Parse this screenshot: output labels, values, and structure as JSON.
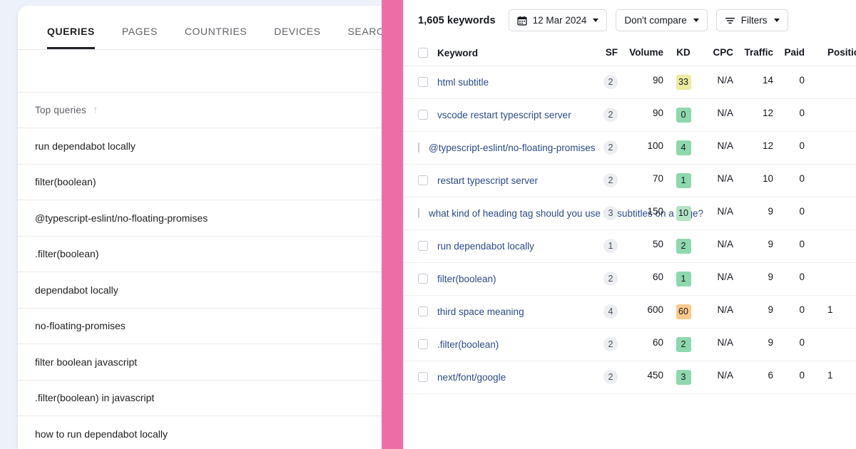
{
  "left_panel": {
    "tabs": [
      {
        "label": "QUERIES",
        "active": true
      },
      {
        "label": "PAGES",
        "active": false
      },
      {
        "label": "COUNTRIES",
        "active": false
      },
      {
        "label": "DEVICES",
        "active": false
      },
      {
        "label": "SEARCH A",
        "active": false
      }
    ],
    "table_header": {
      "queries_label": "Top queries",
      "sort_asc_icon": "arrow-up-icon",
      "sort_desc_icon": "arrow-down-icon"
    },
    "queries": [
      "run dependabot locally",
      "filter(boolean)",
      "@typescript-eslint/no-floating-promises",
      ".filter(boolean)",
      "dependabot locally",
      "no-floating-promises",
      "filter boolean javascript",
      ".filter(boolean) in javascript",
      "how to run dependabot locally"
    ]
  },
  "divider": {
    "color": "#ed6ea7"
  },
  "right_panel": {
    "toolbar": {
      "keyword_count": "1,605 keywords",
      "date_icon": "calendar-icon",
      "date_label": "12 Mar 2024",
      "compare_label": "Don't compare",
      "filters_icon": "filter-icon",
      "filters_label": "Filters"
    },
    "columns": [
      "Keyword",
      "SF",
      "Volume",
      "KD",
      "CPC",
      "Traffic",
      "Paid",
      "Positio"
    ],
    "kd_colors": {
      "green_dark": "#8ed8ae",
      "green_light": "#b3e3c4",
      "yellow": "#ecebA0",
      "orange": "#fbc98a"
    },
    "rows": [
      {
        "keyword": "html subtitle",
        "sf": "2",
        "volume": "90",
        "kd": "33",
        "kd_color": "#eceba0",
        "cpc": "N/A",
        "traffic": "14",
        "paid": "0",
        "position": ""
      },
      {
        "keyword": "vscode restart typescript server",
        "sf": "2",
        "volume": "90",
        "kd": "0",
        "kd_color": "#8ed8ae",
        "cpc": "N/A",
        "traffic": "12",
        "paid": "0",
        "position": ""
      },
      {
        "keyword": "@typescript-eslint/no-floating-promises",
        "sf": "2",
        "volume": "100",
        "kd": "4",
        "kd_color": "#8ed8ae",
        "cpc": "N/A",
        "traffic": "12",
        "paid": "0",
        "position": ""
      },
      {
        "keyword": "restart typescript server",
        "sf": "2",
        "volume": "70",
        "kd": "1",
        "kd_color": "#8ed8ae",
        "cpc": "N/A",
        "traffic": "10",
        "paid": "0",
        "position": ""
      },
      {
        "keyword": "what kind of heading tag should you use for subtitles on a page?",
        "sf": "3",
        "volume": "150",
        "kd": "10",
        "kd_color": "#b3e3c4",
        "cpc": "N/A",
        "traffic": "9",
        "paid": "0",
        "position": ""
      },
      {
        "keyword": "run dependabot locally",
        "sf": "1",
        "volume": "50",
        "kd": "2",
        "kd_color": "#8ed8ae",
        "cpc": "N/A",
        "traffic": "9",
        "paid": "0",
        "position": ""
      },
      {
        "keyword": "filter(boolean)",
        "sf": "2",
        "volume": "60",
        "kd": "1",
        "kd_color": "#8ed8ae",
        "cpc": "N/A",
        "traffic": "9",
        "paid": "0",
        "position": ""
      },
      {
        "keyword": "third space meaning",
        "sf": "4",
        "volume": "600",
        "kd": "60",
        "kd_color": "#fbc98a",
        "cpc": "N/A",
        "traffic": "9",
        "paid": "0",
        "position": "1"
      },
      {
        "keyword": ".filter(boolean)",
        "sf": "2",
        "volume": "60",
        "kd": "2",
        "kd_color": "#8ed8ae",
        "cpc": "N/A",
        "traffic": "9",
        "paid": "0",
        "position": ""
      },
      {
        "keyword": "next/font/google",
        "sf": "2",
        "volume": "450",
        "kd": "3",
        "kd_color": "#8ed8ae",
        "cpc": "N/A",
        "traffic": "6",
        "paid": "0",
        "position": "1"
      }
    ]
  }
}
